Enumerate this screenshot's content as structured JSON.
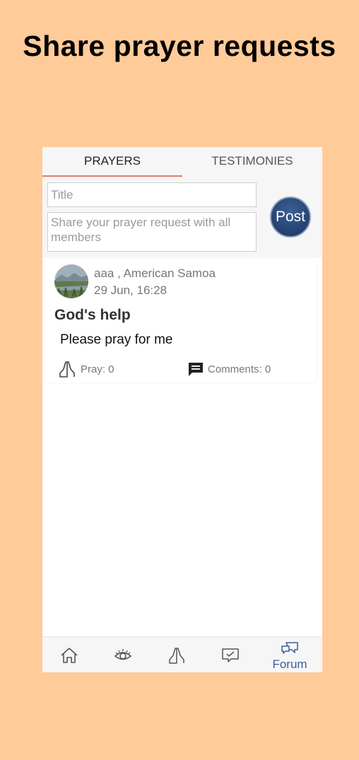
{
  "headline": "Share prayer requests",
  "tabs": [
    {
      "label": "PRAYERS",
      "active": true
    },
    {
      "label": "TESTIMONIES",
      "active": false
    }
  ],
  "compose": {
    "title_placeholder": "Title",
    "body_placeholder": "Share your prayer request with all members",
    "post_label": "Post"
  },
  "post": {
    "author": "aaa  , American Samoa",
    "date": "29 Jun, 16:28",
    "title": "God's help",
    "text": "Please pray for me",
    "pray_label": "Pray: 0",
    "comments_label": "Comments: 0"
  },
  "nav": {
    "items": [
      {
        "icon": "home-icon",
        "label": ""
      },
      {
        "icon": "eye-icon",
        "label": ""
      },
      {
        "icon": "praying-hands-icon",
        "label": ""
      },
      {
        "icon": "checkmark-message-icon",
        "label": ""
      },
      {
        "icon": "forum-icon",
        "label": "Forum",
        "active": true
      }
    ]
  },
  "colors": {
    "background": "#ffcb99",
    "accent": "#3b5f96",
    "tab_underline": "#e07a6e"
  }
}
